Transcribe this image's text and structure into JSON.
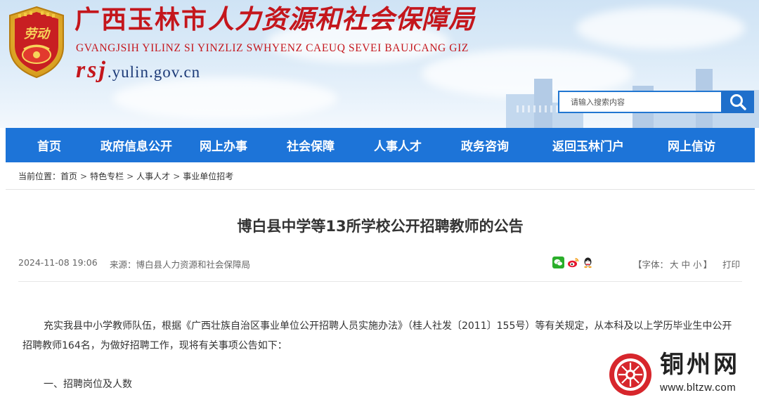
{
  "header": {
    "title_prefix": "广西玉林市",
    "title_main": "人力资源和社会保障局",
    "title_en": "GVANGJSIH YILINZ SI YINZLIZ SWHYENZ CAEUQ SEVEI BAUJCANG GIZ",
    "domain_prefix": "rsj",
    "domain_rest": ".yulin.gov.cn",
    "emblem_text": "劳动"
  },
  "search": {
    "placeholder": "请输入搜索内容",
    "button_icon": "search-icon"
  },
  "nav": {
    "items": [
      {
        "label": "首页"
      },
      {
        "label": "政府信息公开"
      },
      {
        "label": "网上办事"
      },
      {
        "label": "社会保障"
      },
      {
        "label": "人事人才"
      },
      {
        "label": "政务咨询"
      },
      {
        "label": "返回玉林门户"
      },
      {
        "label": "网上信访"
      }
    ]
  },
  "breadcrumb": {
    "prefix": "当前位置：",
    "items": [
      "首页",
      "特色专栏",
      "人事人才",
      "事业单位招考"
    ],
    "separator": ">"
  },
  "article": {
    "title": "博白县中学等13所学校公开招聘教师的公告",
    "date": "2024-11-08 19:06",
    "source_label": "来源：",
    "source": "博白县人力资源和社会保障局",
    "share_icons": [
      "wechat-icon",
      "weibo-icon",
      "qq-icon"
    ],
    "font_label_open": "【字体：",
    "font_sizes": [
      "大",
      "中",
      "小"
    ],
    "font_label_close": "】",
    "print_label": "打印",
    "paragraph": "充实我县中小学教师队伍，根据《广西壮族自治区事业单位公开招聘人员实施办法》（桂人社发〔2011〕155号）等有关规定，从本科及以上学历毕业生中公开招聘教师164名，为做好招聘工作，现将有关事项公告如下：",
    "section_heading": "一、招聘岗位及人数"
  },
  "watermark": {
    "name": "铜州网",
    "url": "www.bltzw.com"
  },
  "colors": {
    "brand_red": "#c4161c",
    "nav_blue": "#1d74d8",
    "search_blue": "#1f6fcb"
  }
}
